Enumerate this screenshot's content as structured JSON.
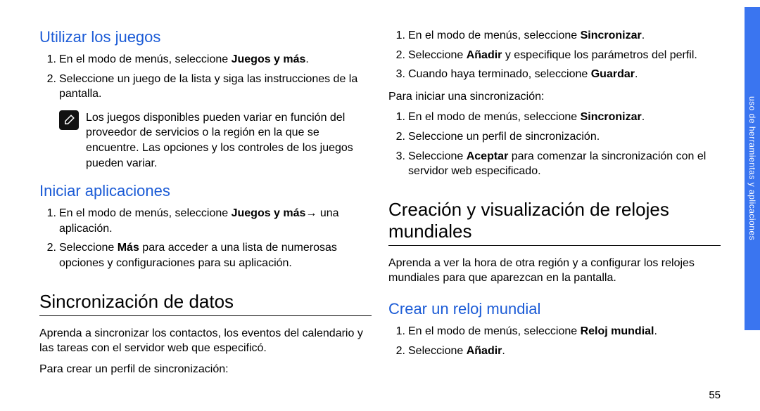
{
  "left": {
    "h_games": "Utilizar los juegos",
    "games_steps": [
      {
        "pre": "En el modo de menús, seleccione ",
        "bold": "Juegos y más",
        "post": "."
      },
      {
        "pre": "Seleccione un juego de la lista y siga las instrucciones de la pantalla.",
        "bold": "",
        "post": ""
      }
    ],
    "note_text": "Los juegos disponibles pueden variar en función del proveedor de servicios o la región en la que se encuentre. Las opciones y los controles de los juegos pueden variar.",
    "h_apps": "Iniciar aplicaciones",
    "apps_steps": [
      {
        "pre": "En el modo de menús, seleccione ",
        "bold": "Juegos y más",
        "post": "→ una aplicación."
      },
      {
        "pre": "Seleccione ",
        "bold": "Más",
        "post": " para acceder a una lista de numerosas opciones y configuraciones para su aplicación."
      }
    ],
    "h_sync": "Sincronización de datos",
    "sync_intro": "Aprenda a sincronizar los contactos, los eventos del calendario y las tareas con el servidor web que especificó.",
    "sync_sub": "Para crear un perfil de sincronización:"
  },
  "right": {
    "profile_steps": [
      {
        "pre": "En el modo de menús, seleccione ",
        "bold": "Sincronizar",
        "post": "."
      },
      {
        "pre": "Seleccione ",
        "bold": "Añadir",
        "post": " y especifique los parámetros del perfil."
      },
      {
        "pre": "Cuando haya terminado, seleccione ",
        "bold": "Guardar",
        "post": "."
      }
    ],
    "start_sub": "Para iniciar una sincronización:",
    "start_steps": [
      {
        "pre": "En el modo de menús, seleccione ",
        "bold": "Sincronizar",
        "post": "."
      },
      {
        "pre": "Seleccione un perfil de sincronización.",
        "bold": "",
        "post": ""
      },
      {
        "pre": "Seleccione ",
        "bold": "Aceptar",
        "post": " para comenzar la sincronización con el servidor web especificado."
      }
    ],
    "h_clocks": "Creación y visualización de relojes mundiales",
    "clocks_intro": "Aprenda a ver la hora de otra región y a configurar los relojes mundiales para que aparezcan en la pantalla.",
    "h_create_clock": "Crear un reloj mundial",
    "create_steps": [
      {
        "pre": "En el modo de menús, seleccione ",
        "bold": "Reloj mundial",
        "post": "."
      },
      {
        "pre": "Seleccione ",
        "bold": "Añadir",
        "post": "."
      }
    ]
  },
  "side_tab_label": "uso de herramientas y aplicaciones",
  "page_number": "55"
}
